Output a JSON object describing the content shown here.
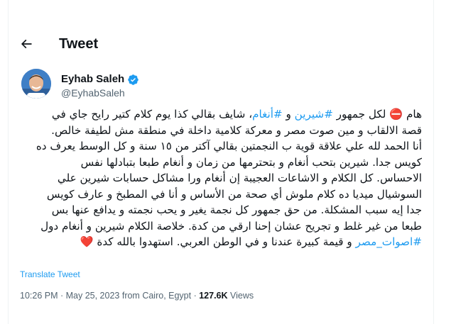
{
  "header": {
    "title": "Tweet"
  },
  "author": {
    "name": "Eyhab Saleh",
    "handle": "@EyhabSaleh"
  },
  "tweet": {
    "lines": [
      {
        "pre": "هام ⛔ لكل جمهور ",
        "tag1": "#شيرين",
        "mid": " و ",
        "tag2": "#أنغام",
        "post": "، شايف بقالي كذا يوم كلام كتير رايح جاي في"
      },
      "قصة الالقاب و مين صوت مصر و معركة كلامية داخلة في منطقة مش لطيفة خالص.",
      "أنا الحمد لله علي علاقة قوية ب النجمتين بقالي آكتر من ١٥ سنة و كل الوسط يعرف ده",
      "كويس جدا. شيرين بتحب أنغام و بتحترمها من زمان و أنغام طبعا بتبادلها نفس",
      "الاحساس. كل الكلام و الاشاعات العجيبة إن أنغام ورا مشاكل حسابات شيرين علي",
      "السوشيال ميديا ده كلام ملوش أي صحة من الأساس و أنا في المطبخ و عارف كويس",
      "جدا إيه سبب المشكلة. من حق جمهور كل نجمة يغير و يحب نجمته و يدافع عنها بس",
      "طبعا من غير غلط و تجريح عشان إحنا ارقي من كدة. خلاصة الكلام شيرين و أنغام دول",
      {
        "tag": "#اصوات_مصر",
        "post": " و قيمة كبيرة عندنا و في الوطن العربي. استهدوا بالله كدة ",
        "heart": "❤️"
      }
    ]
  },
  "translate_label": "Translate Tweet",
  "meta": {
    "time": "10:26 PM",
    "sep1": " · ",
    "date": "May 25, 2023",
    "location": " from Cairo, Egypt",
    "sep2": " · ",
    "views_count": "127.6K",
    "views_label": " Views"
  },
  "colors": {
    "link": "#1d9bf0",
    "text": "#0f1419",
    "secondary": "#536471",
    "verified": "#1d9bf0"
  },
  "icons": {
    "back": "arrow-left-icon",
    "verified": "verified-badge-icon"
  }
}
